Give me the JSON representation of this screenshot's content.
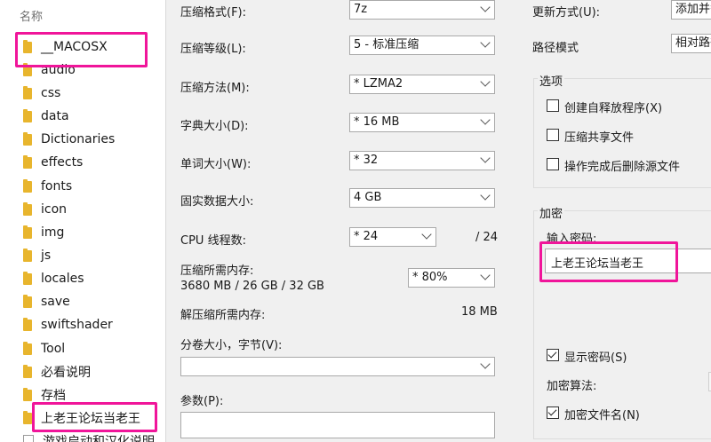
{
  "explorer": {
    "column_header": "名称",
    "items": [
      {
        "name": "__MACOSX",
        "type": "folder"
      },
      {
        "name": "audio",
        "type": "folder"
      },
      {
        "name": "css",
        "type": "folder"
      },
      {
        "name": "data",
        "type": "folder"
      },
      {
        "name": "Dictionaries",
        "type": "folder"
      },
      {
        "name": "effects",
        "type": "folder"
      },
      {
        "name": "fonts",
        "type": "folder"
      },
      {
        "name": "icon",
        "type": "folder"
      },
      {
        "name": "img",
        "type": "folder"
      },
      {
        "name": "js",
        "type": "folder"
      },
      {
        "name": "locales",
        "type": "folder"
      },
      {
        "name": "save",
        "type": "folder"
      },
      {
        "name": "swiftshader",
        "type": "folder"
      },
      {
        "name": "Tool",
        "type": "folder"
      },
      {
        "name": "必看说明",
        "type": "folder"
      },
      {
        "name": "存档",
        "type": "folder"
      },
      {
        "name": "上老王论坛当老王",
        "type": "folder"
      },
      {
        "name": "游戏启动和汉化说明",
        "type": "file"
      }
    ]
  },
  "settings": {
    "format_label": "压缩格式(F):",
    "format_value": "7z",
    "level_label": "压缩等级(L):",
    "level_value": "5 - 标准压缩",
    "method_label": "压缩方法(M):",
    "method_value": "* LZMA2",
    "dict_label": "字典大小(D):",
    "dict_value": "* 16 MB",
    "word_label": "单词大小(W):",
    "word_value": "* 32",
    "solid_label": "固实数据大小:",
    "solid_value": "4 GB",
    "threads_label": "CPU 线程数:",
    "threads_value": "* 24",
    "threads_max": "/ 24",
    "mem_compress_label": "压缩所需内存:",
    "mem_compress_value": "3680 MB / 26 GB / 32 GB",
    "mem_percent": "* 80%",
    "mem_decompress_label": "解压缩所需内存:",
    "mem_decompress_value": "18 MB",
    "split_label": "分卷大小，字节(V):",
    "split_value": "",
    "params_label": "参数(P):",
    "params_value": ""
  },
  "right": {
    "update_label": "更新方式(U):",
    "update_value": "添加并替",
    "path_label": "路径模式",
    "path_value": "相对路径",
    "options_title": "选项",
    "opt_sfx": "创建自释放程序(X)",
    "opt_shared": "压缩共享文件",
    "opt_delete": "操作完成后删除源文件",
    "encrypt_title": "加密",
    "password_label": "输入密码:",
    "password_value": "上老王论坛当老王",
    "show_password": "显示密码(S)",
    "enc_method_label": "加密算法:",
    "encrypt_names": "加密文件名(N)"
  },
  "colors": {
    "highlight": "#f0159a",
    "folder": "#e8b52d",
    "dialog_bg": "#f0f0f0"
  }
}
